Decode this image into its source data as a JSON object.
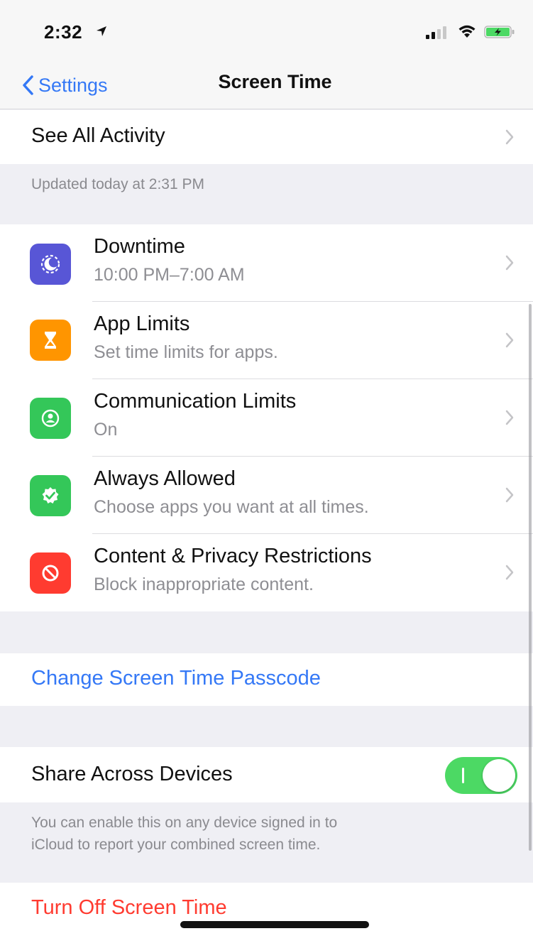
{
  "status_bar": {
    "time": "2:32",
    "icons": [
      "location-arrow-icon",
      "cellular-signal-icon",
      "wifi-icon",
      "battery-charging-icon"
    ],
    "battery_color": "#4cd964"
  },
  "nav": {
    "back_label": "Settings",
    "title": "Screen Time",
    "accent_color": "#3478f6"
  },
  "activity": {
    "label": "See All Activity",
    "updated_note": "Updated today at 2:31 PM"
  },
  "features": [
    {
      "label": "Downtime",
      "subtitle": "10:00 PM–7:00 AM",
      "icon": "downtime-icon",
      "color": "#5856d6"
    },
    {
      "label": "App Limits",
      "subtitle": "Set time limits for apps.",
      "icon": "hourglass-icon",
      "color": "#ff9500"
    },
    {
      "label": "Communication Limits",
      "subtitle": "On",
      "icon": "contact-icon",
      "color": "#34c759"
    },
    {
      "label": "Always Allowed",
      "subtitle": "Choose apps you want at all times.",
      "icon": "checkmark-badge-icon",
      "color": "#34c759"
    },
    {
      "label": "Content & Privacy Restrictions",
      "subtitle": "Block inappropriate content.",
      "icon": "no-entry-icon",
      "color": "#ff3b30"
    }
  ],
  "passcode": {
    "label": "Change Screen Time Passcode",
    "color": "#3478f6"
  },
  "share": {
    "label": "Share Across Devices",
    "enabled": true,
    "note_line1": "You can enable this on any device signed in to",
    "note_line2": "iCloud to report your combined screen time."
  },
  "turn_off": {
    "label": "Turn Off Screen Time",
    "color": "#ff3b30"
  }
}
